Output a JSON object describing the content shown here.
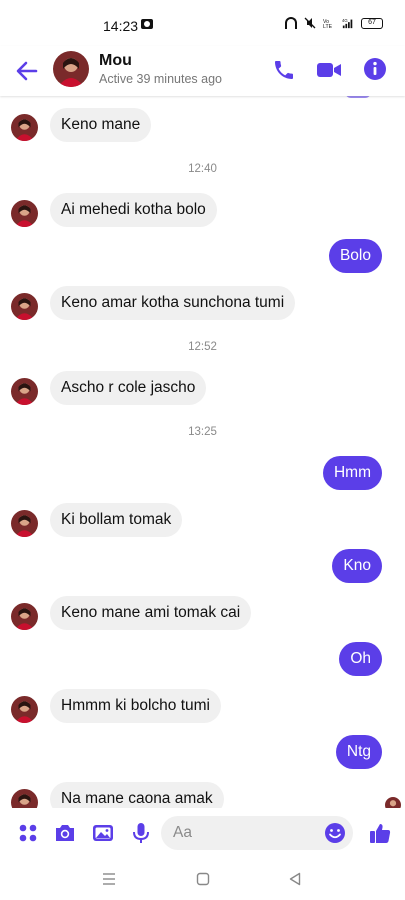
{
  "status_bar": {
    "time": "14:23",
    "battery": "67",
    "icons": [
      "camera-icon",
      "headphone-icon",
      "mute-icon",
      "volte-icon",
      "signal-4g-icon",
      "battery-icon"
    ]
  },
  "header": {
    "name": "Mou",
    "status": "Active 39 minutes ago",
    "icons": [
      "back-arrow-icon",
      "phone-icon",
      "video-camera-icon",
      "info-icon"
    ]
  },
  "colors": {
    "accent": "#5b3ee8",
    "incoming_bubble": "#f0f0f0",
    "timestamp": "#8a8a8a"
  },
  "messages": [
    {
      "type": "in",
      "text": "Keno mane"
    },
    {
      "type": "time",
      "text": "12:40"
    },
    {
      "type": "in",
      "text": "Ai mehedi kotha bolo"
    },
    {
      "type": "out",
      "text": "Bolo"
    },
    {
      "type": "in",
      "text": "Keno amar kotha sunchona tumi"
    },
    {
      "type": "time",
      "text": "12:52"
    },
    {
      "type": "in",
      "text": "Ascho r cole jascho"
    },
    {
      "type": "time",
      "text": "13:25"
    },
    {
      "type": "out",
      "text": "Hmm"
    },
    {
      "type": "in",
      "text": "Ki bollam tomak"
    },
    {
      "type": "out",
      "text": "Kno"
    },
    {
      "type": "in",
      "text": "Keno mane ami tomak cai"
    },
    {
      "type": "out",
      "text": "Oh"
    },
    {
      "type": "in",
      "text": "Hmmm ki bolcho tumi"
    },
    {
      "type": "out",
      "text": "Ntg"
    },
    {
      "type": "in",
      "text": "Na mane caona amak"
    }
  ],
  "composer": {
    "placeholder": "Aa",
    "icons": [
      "menu-dots-icon",
      "camera-icon",
      "gallery-icon",
      "microphone-icon",
      "emoji-icon",
      "thumbs-up-icon"
    ]
  },
  "nav_bar": {
    "icons": [
      "menu-lines-icon",
      "home-square-icon",
      "back-triangle-icon"
    ]
  }
}
